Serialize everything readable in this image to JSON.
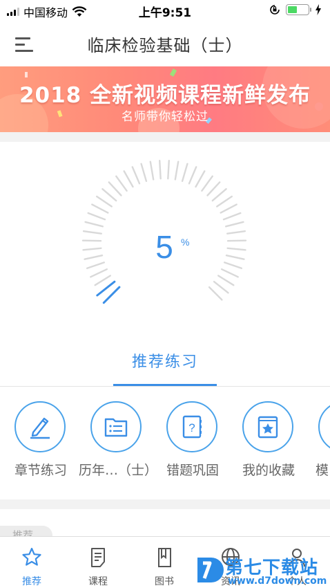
{
  "status_bar": {
    "carrier": "中国移动",
    "time": "上午9:51",
    "battery_level": 0.45
  },
  "nav": {
    "title": "临床检验基础（士）",
    "menu_icon": "menu-icon"
  },
  "banner": {
    "headline": "2018 全新视频课程新鲜发布",
    "subtitle": "名师带你轻松过"
  },
  "progress": {
    "value": 5,
    "unit": "%",
    "total_ticks": 42,
    "accent_color": "#3a8ee6",
    "track_color": "#d9d9d9"
  },
  "section_tab": {
    "label": "推荐练习"
  },
  "practice_items": [
    {
      "label": "章节练习",
      "icon": "pen-paper-icon"
    },
    {
      "label": "历年…（士）",
      "icon": "folder-list-icon"
    },
    {
      "label": "错题巩固",
      "icon": "question-book-icon"
    },
    {
      "label": "我的收藏",
      "icon": "star-book-icon"
    },
    {
      "label": "模",
      "icon": "partial-icon"
    }
  ],
  "partial_tag": "推荐",
  "bottom_tabs": [
    {
      "label": "推荐",
      "icon": "star-icon",
      "active": true
    },
    {
      "label": "课程",
      "icon": "notebook-icon",
      "active": false
    },
    {
      "label": "图书",
      "icon": "book-icon",
      "active": false
    },
    {
      "label": "资讯",
      "icon": "globe-icon",
      "active": false
    },
    {
      "label": "个人",
      "icon": "user-icon",
      "active": false
    }
  ],
  "watermark": {
    "text": "第七下载站",
    "url": "www.d7down.com"
  }
}
